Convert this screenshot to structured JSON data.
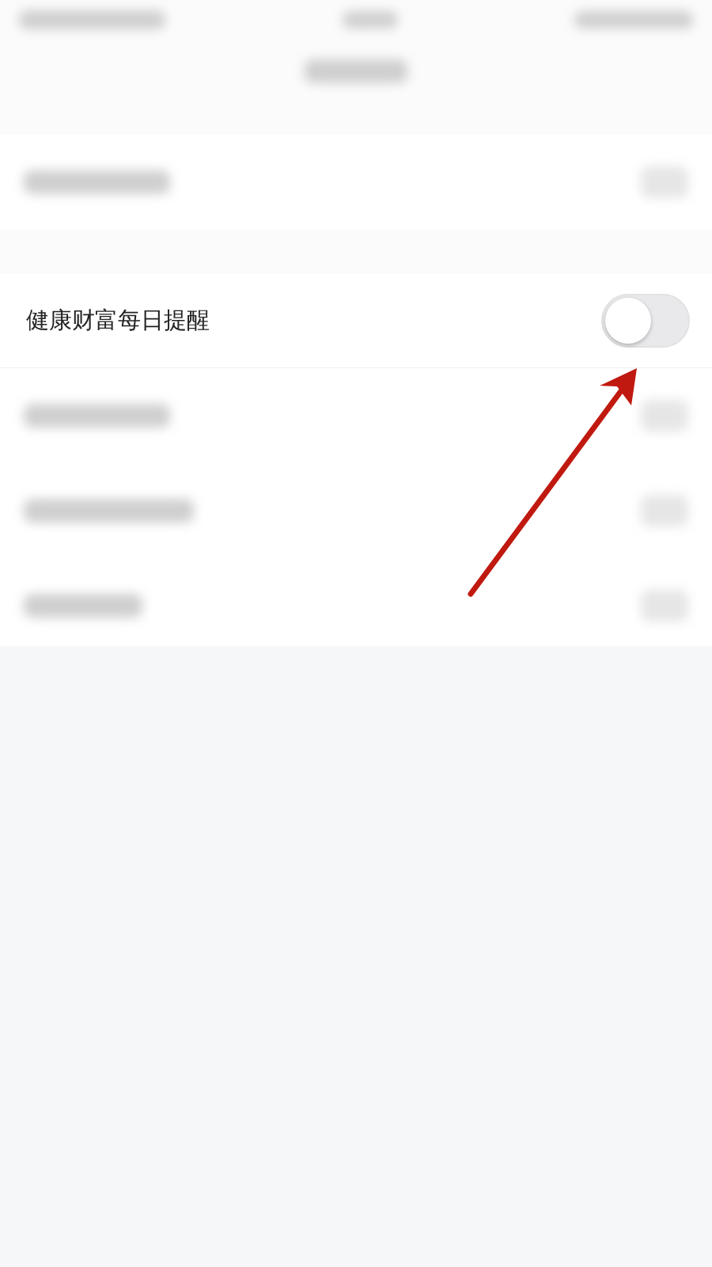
{
  "settings": [
    {
      "label": "健康财富每日提醒",
      "on": false
    }
  ]
}
